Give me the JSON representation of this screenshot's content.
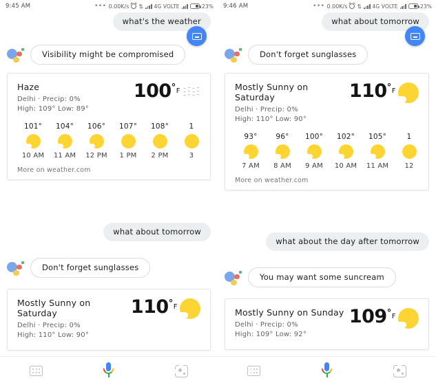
{
  "colors": {
    "accent_blue": "#4285f4",
    "sun_yellow": "#fcd535",
    "bubble_gray": "#eceff1",
    "text_dark": "#1d1d1d",
    "text_muted": "#5f6368"
  },
  "panels": [
    {
      "id": "panel-top-left",
      "status": {
        "time": "9:45 AM",
        "speed": "0.00K/s",
        "network": "4G VOLTE",
        "battery": "23%"
      },
      "user_query": "what's the weather",
      "assistant_reply": "Visibility might be compromised",
      "card": {
        "condition": "Haze",
        "icon": "haze-icon",
        "temperature": "100",
        "degree": "°",
        "unit": "F",
        "location_precip": "Delhi · Precip: 0%",
        "high_low": "High: 109° Low: 89°",
        "source": "More on weather.com",
        "hourly": [
          {
            "temp": "101°",
            "icon": "sun-cloud-icon",
            "label": "10 AM"
          },
          {
            "temp": "104°",
            "icon": "sun-cloud-icon",
            "label": "11 AM"
          },
          {
            "temp": "106°",
            "icon": "sun-cloud-icon",
            "label": "12 PM"
          },
          {
            "temp": "107°",
            "icon": "sun-icon",
            "label": "1 PM"
          },
          {
            "temp": "108°",
            "icon": "sun-icon",
            "label": "2 PM"
          },
          {
            "temp": "1",
            "icon": "sun-icon",
            "label": "3"
          }
        ]
      }
    },
    {
      "id": "panel-top-right",
      "status": {
        "time": "9:46 AM",
        "speed": "0.00K/s",
        "network": "4G VOLTE",
        "battery": "23%"
      },
      "user_query": "what about tomorrow",
      "assistant_reply": "Don't forget sunglasses",
      "card": {
        "condition": "Mostly Sunny on\nSaturday",
        "icon": "sun-cloud-icon",
        "temperature": "110",
        "degree": "°",
        "unit": "F",
        "location_precip": "Delhi · Precip: 0%",
        "high_low": "High: 110° Low: 90°",
        "source": "More on weather.com",
        "hourly": [
          {
            "temp": "93°",
            "icon": "sun-cloud-icon",
            "label": "7 AM"
          },
          {
            "temp": "96°",
            "icon": "sun-cloud-icon",
            "label": "8 AM"
          },
          {
            "temp": "100°",
            "icon": "sun-cloud-icon",
            "label": "9 AM"
          },
          {
            "temp": "102°",
            "icon": "sun-cloud-icon",
            "label": "10 AM"
          },
          {
            "temp": "105°",
            "icon": "sun-cloud-icon",
            "label": "11 AM"
          },
          {
            "temp": "1",
            "icon": "sun-icon",
            "label": "12"
          }
        ]
      }
    },
    {
      "id": "panel-bottom-left",
      "user_query": "what about tomorrow",
      "assistant_reply": "Don't forget sunglasses",
      "card": {
        "condition": "Mostly Sunny on\nSaturday",
        "icon": "sun-cloud-icon",
        "temperature": "110",
        "degree": "°",
        "unit": "F",
        "location_precip": "Delhi · Precip: 0%",
        "high_low": "High: 110° Low: 90°"
      }
    },
    {
      "id": "panel-bottom-right",
      "user_query": "what about the day after tomorrow",
      "assistant_reply": "You may want some suncream",
      "card": {
        "condition": "Mostly Sunny on Sunday",
        "icon": "sun-cloud-icon",
        "temperature": "109",
        "degree": "°",
        "unit": "F",
        "location_precip": "Delhi · Precip: 0%",
        "high_low": "High: 109° Low: 92°"
      }
    }
  ],
  "nav": {
    "apps_label": "apps-icon",
    "mic_label": "google-mic-icon",
    "lens_label": "google-lens-icon"
  }
}
